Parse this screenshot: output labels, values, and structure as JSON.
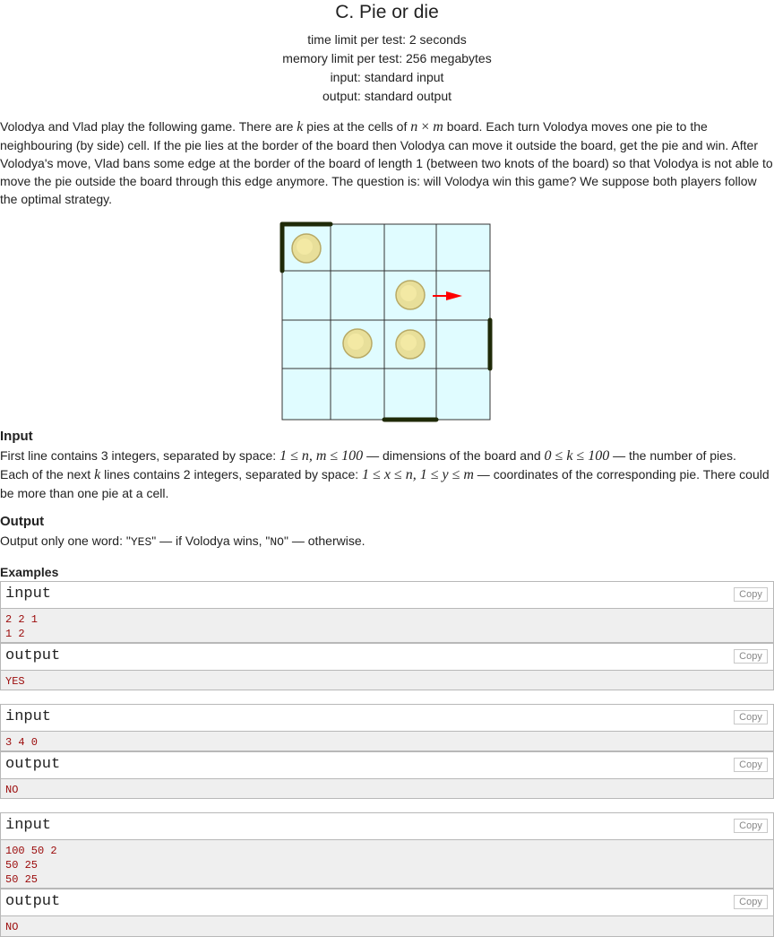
{
  "problem": {
    "title": "C. Pie or die",
    "time_limit": "time limit per test: 2 seconds",
    "memory_limit": "memory limit per test: 256 megabytes",
    "input_file": "input: standard input",
    "output_file": "output: standard output"
  },
  "statement": {
    "p1": "Volodya and Vlad play the following game. There are ",
    "k": "k",
    "p2": " pies at the cells of ",
    "n": "n",
    "times": " × ",
    "m": "m",
    "p3": " board. Each turn Volodya moves one pie to the neighbouring (by side) cell. If the pie lies at the border of the board then Volodya can move it outside the board, get the pie and win. After Volodya's move, Vlad bans some edge at the border of the board of length 1 (between two knots of the board) so that Volodya is not able to move the pie outside the board through this edge anymore. The question is: will Volodya win this game? We suppose both players follow the optimal strategy."
  },
  "input_section": {
    "heading": "Input",
    "l1a": "First line contains 3 integers, separated by space: ",
    "l1m1": "1 ≤ n, m ≤ 100",
    "l1b": " — dimensions of the board and ",
    "l1m2": "0 ≤ k ≤ 100",
    "l1c": " — the number of pies.",
    "l2a": "Each of the next ",
    "l2k": "k",
    "l2b": " lines contains 2 integers, separated by space: ",
    "l2m1": "1 ≤ x ≤ n, 1 ≤ y ≤ m",
    "l2c": " — coordinates of the corresponding pie. There could be more than one pie at a cell."
  },
  "output_section": {
    "heading": "Output",
    "t1": "Output only one word: \"",
    "yes": "YES",
    "t2": "\" — if Volodya wins, \"",
    "no": "NO",
    "t3": "\" — otherwise."
  },
  "examples": {
    "heading": "Examples",
    "input_label": "input",
    "output_label": "output",
    "copy_label": "Copy",
    "e1_input": "2 2 1\n1 2",
    "e1_output": "YES",
    "e2_input": "3 4 0",
    "e2_output": "NO",
    "e3_input": "100 50 2\n50 25\n50 25",
    "e3_output": "NO"
  },
  "colors": {
    "board_fill": "#e0fcff",
    "grid_line": "#333333",
    "banned_edge": "#1f2a08",
    "pie": "#e8df9a",
    "arrow": "#ff0000",
    "sample_text": "#9b0a0a"
  }
}
